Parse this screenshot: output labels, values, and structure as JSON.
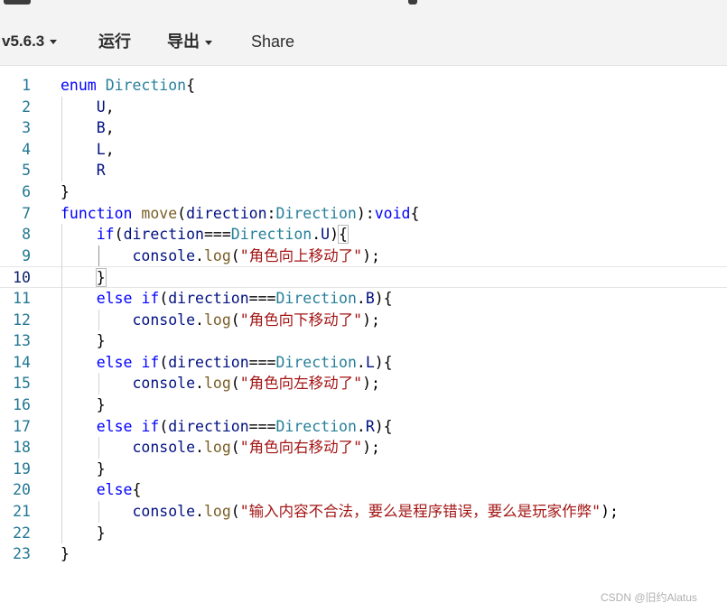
{
  "toolbar": {
    "version_label": "v5.6.3",
    "run_label": "运行",
    "export_label": "导出",
    "share_label": "Share"
  },
  "editor": {
    "current_line": 10,
    "lines": [
      {
        "n": "1",
        "tokens": [
          [
            "kw",
            "enum"
          ],
          [
            "pl",
            " "
          ],
          [
            "ty",
            "Direction"
          ],
          [
            "pl",
            "{"
          ]
        ]
      },
      {
        "n": "2",
        "tokens": [
          [
            "pl",
            "    "
          ],
          [
            "id",
            "U"
          ],
          [
            "pl",
            ","
          ]
        ]
      },
      {
        "n": "3",
        "tokens": [
          [
            "pl",
            "    "
          ],
          [
            "id",
            "B"
          ],
          [
            "pl",
            ","
          ]
        ]
      },
      {
        "n": "4",
        "tokens": [
          [
            "pl",
            "    "
          ],
          [
            "id",
            "L"
          ],
          [
            "pl",
            ","
          ]
        ]
      },
      {
        "n": "5",
        "tokens": [
          [
            "pl",
            "    "
          ],
          [
            "id",
            "R"
          ]
        ]
      },
      {
        "n": "6",
        "tokens": [
          [
            "pl",
            "}"
          ]
        ]
      },
      {
        "n": "7",
        "tokens": [
          [
            "kw",
            "function"
          ],
          [
            "pl",
            " "
          ],
          [
            "fn",
            "move"
          ],
          [
            "pl",
            "("
          ],
          [
            "id",
            "direction"
          ],
          [
            "pl",
            ":"
          ],
          [
            "ty",
            "Direction"
          ],
          [
            "pl",
            "):"
          ],
          [
            "kw",
            "void"
          ],
          [
            "pl",
            "{"
          ]
        ]
      },
      {
        "n": "8",
        "tokens": [
          [
            "pl",
            "    "
          ],
          [
            "kw",
            "if"
          ],
          [
            "pl",
            "("
          ],
          [
            "id",
            "direction"
          ],
          [
            "pl",
            "==="
          ],
          [
            "ty",
            "Direction"
          ],
          [
            "pl",
            "."
          ],
          [
            "id",
            "U"
          ],
          [
            "pl",
            ")"
          ],
          [
            "box",
            "{"
          ]
        ]
      },
      {
        "n": "9",
        "tokens": [
          [
            "pl",
            "        "
          ],
          [
            "id",
            "console"
          ],
          [
            "pl",
            "."
          ],
          [
            "fn",
            "log"
          ],
          [
            "pl",
            "("
          ],
          [
            "str",
            "\"角色向上移动了\""
          ],
          [
            "pl",
            ");"
          ]
        ]
      },
      {
        "n": "10",
        "tokens": [
          [
            "pl",
            "    "
          ],
          [
            "box",
            "}"
          ]
        ]
      },
      {
        "n": "11",
        "tokens": [
          [
            "pl",
            "    "
          ],
          [
            "kw",
            "else"
          ],
          [
            "pl",
            " "
          ],
          [
            "kw",
            "if"
          ],
          [
            "pl",
            "("
          ],
          [
            "id",
            "direction"
          ],
          [
            "pl",
            "==="
          ],
          [
            "ty",
            "Direction"
          ],
          [
            "pl",
            "."
          ],
          [
            "id",
            "B"
          ],
          [
            "pl",
            "){"
          ]
        ]
      },
      {
        "n": "12",
        "tokens": [
          [
            "pl",
            "        "
          ],
          [
            "id",
            "console"
          ],
          [
            "pl",
            "."
          ],
          [
            "fn",
            "log"
          ],
          [
            "pl",
            "("
          ],
          [
            "str",
            "\"角色向下移动了\""
          ],
          [
            "pl",
            ");"
          ]
        ]
      },
      {
        "n": "13",
        "tokens": [
          [
            "pl",
            "    }"
          ]
        ]
      },
      {
        "n": "14",
        "tokens": [
          [
            "pl",
            "    "
          ],
          [
            "kw",
            "else"
          ],
          [
            "pl",
            " "
          ],
          [
            "kw",
            "if"
          ],
          [
            "pl",
            "("
          ],
          [
            "id",
            "direction"
          ],
          [
            "pl",
            "==="
          ],
          [
            "ty",
            "Direction"
          ],
          [
            "pl",
            "."
          ],
          [
            "id",
            "L"
          ],
          [
            "pl",
            "){"
          ]
        ]
      },
      {
        "n": "15",
        "tokens": [
          [
            "pl",
            "        "
          ],
          [
            "id",
            "console"
          ],
          [
            "pl",
            "."
          ],
          [
            "fn",
            "log"
          ],
          [
            "pl",
            "("
          ],
          [
            "str",
            "\"角色向左移动了\""
          ],
          [
            "pl",
            ");"
          ]
        ]
      },
      {
        "n": "16",
        "tokens": [
          [
            "pl",
            "    }"
          ]
        ]
      },
      {
        "n": "17",
        "tokens": [
          [
            "pl",
            "    "
          ],
          [
            "kw",
            "else"
          ],
          [
            "pl",
            " "
          ],
          [
            "kw",
            "if"
          ],
          [
            "pl",
            "("
          ],
          [
            "id",
            "direction"
          ],
          [
            "pl",
            "==="
          ],
          [
            "ty",
            "Direction"
          ],
          [
            "pl",
            "."
          ],
          [
            "id",
            "R"
          ],
          [
            "pl",
            "){"
          ]
        ]
      },
      {
        "n": "18",
        "tokens": [
          [
            "pl",
            "        "
          ],
          [
            "id",
            "console"
          ],
          [
            "pl",
            "."
          ],
          [
            "fn",
            "log"
          ],
          [
            "pl",
            "("
          ],
          [
            "str",
            "\"角色向右移动了\""
          ],
          [
            "pl",
            ");"
          ]
        ]
      },
      {
        "n": "19",
        "tokens": [
          [
            "pl",
            "    }"
          ]
        ]
      },
      {
        "n": "20",
        "tokens": [
          [
            "pl",
            "    "
          ],
          [
            "kw",
            "else"
          ],
          [
            "pl",
            "{"
          ]
        ]
      },
      {
        "n": "21",
        "tokens": [
          [
            "pl",
            "        "
          ],
          [
            "id",
            "console"
          ],
          [
            "pl",
            "."
          ],
          [
            "fn",
            "log"
          ],
          [
            "pl",
            "("
          ],
          [
            "str",
            "\"输入内容不合法，要么是程序错误，要么是玩家作弊\""
          ],
          [
            "pl",
            ");"
          ]
        ]
      },
      {
        "n": "22",
        "tokens": [
          [
            "pl",
            "    }"
          ]
        ]
      },
      {
        "n": "23",
        "tokens": [
          [
            "pl",
            "}"
          ]
        ]
      }
    ]
  },
  "watermark": "CSDN @旧约Alatus",
  "colors": {
    "keyword": "#0000ff",
    "type": "#267f99",
    "function": "#795e26",
    "string": "#a31515",
    "line_number": "#237893"
  }
}
